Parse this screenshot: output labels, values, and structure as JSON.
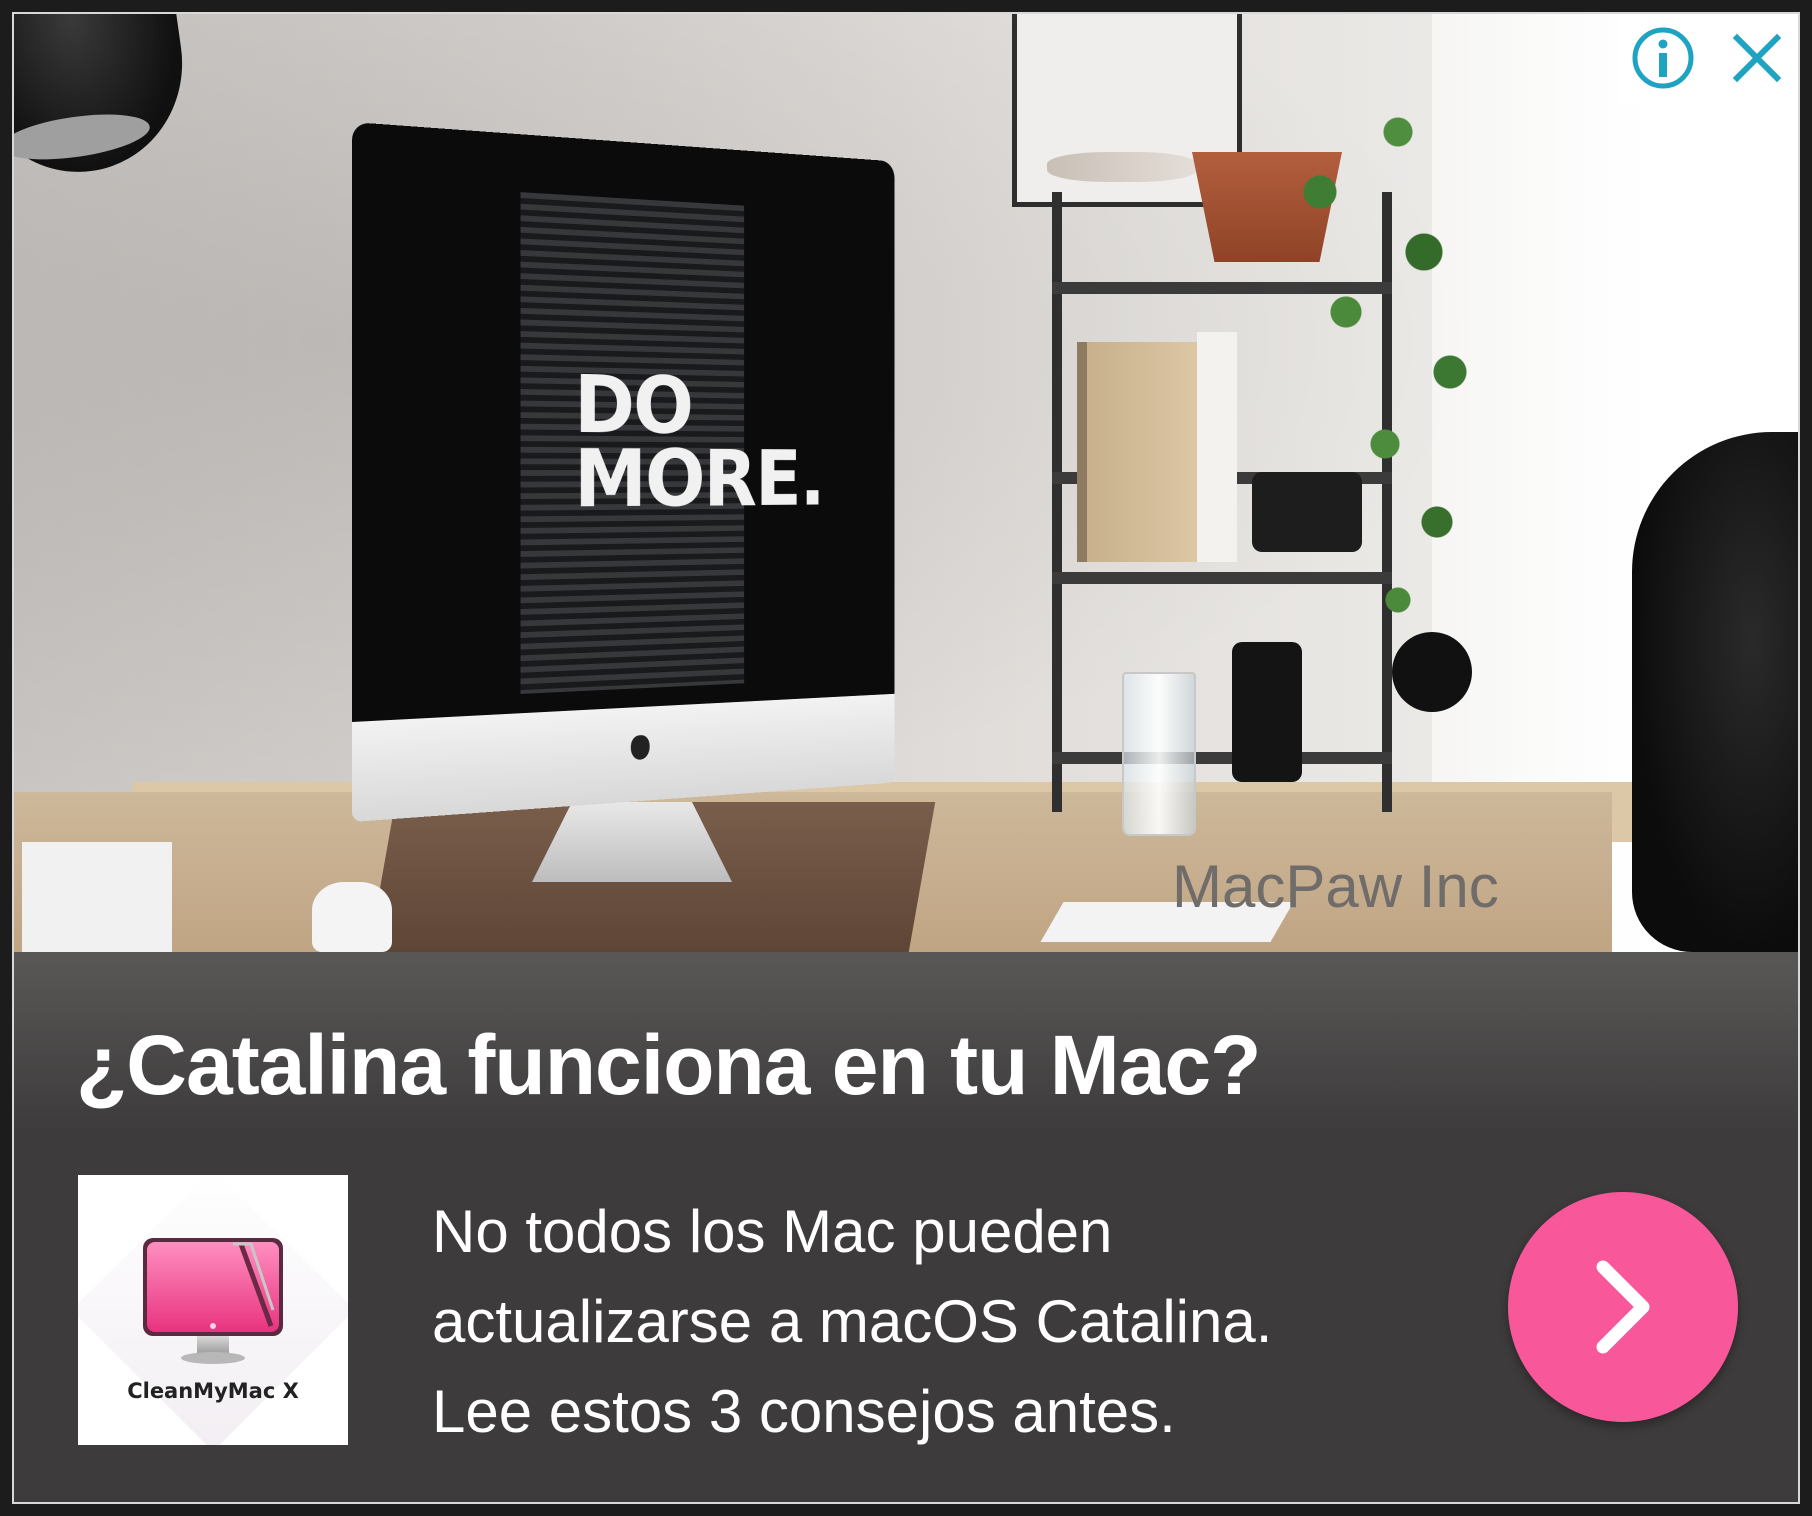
{
  "ad": {
    "photo": {
      "screen_text_line1": "DO",
      "screen_text_line2": "MORE.",
      "watermark": "MacPaw Inc"
    },
    "controls": {
      "info_icon": "info-icon",
      "close_icon": "close-icon",
      "accent_color": "#1ea3c3"
    },
    "headline": "¿Catalina funciona en tu Mac?",
    "app": {
      "name": "CleanMyMac X",
      "icon": "cleanmymac-monitor-icon"
    },
    "body_lines": [
      "No todos los Mac pueden",
      "actualizarse a macOS Catalina.",
      "Lee estos 3 consejos antes."
    ],
    "cta": {
      "icon": "chevron-right-icon",
      "color": "#f8589a"
    },
    "colors": {
      "background": "#3d3b3b",
      "text": "#ffffff"
    }
  }
}
